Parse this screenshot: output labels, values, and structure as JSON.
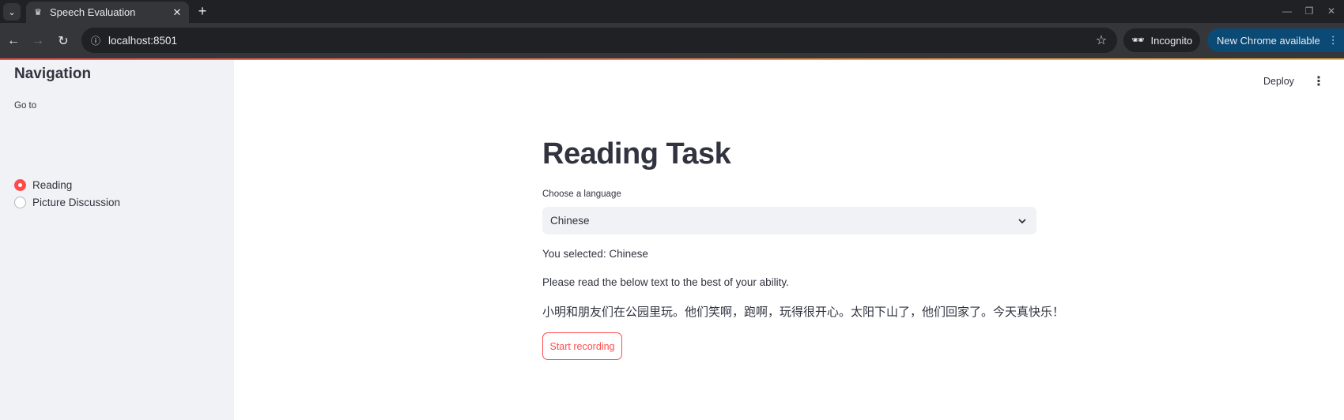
{
  "browser": {
    "tab_title": "Speech Evaluation",
    "url": "localhost:8501",
    "incognito_label": "Incognito",
    "update_label": "New Chrome available"
  },
  "sidebar": {
    "title": "Navigation",
    "radio_label": "Go to",
    "options": [
      {
        "label": "Reading",
        "selected": true
      },
      {
        "label": "Picture Discussion",
        "selected": false
      }
    ]
  },
  "header": {
    "deploy_label": "Deploy"
  },
  "main": {
    "title": "Reading Task",
    "language_select": {
      "label": "Choose a language",
      "value": "Chinese"
    },
    "selected_text": "You selected: Chinese",
    "instruction": "Please read the below text to the best of your ability.",
    "reading_text": "小明和朋友们在公园里玩。他们笑啊，跑啊，玩得很开心。太阳下山了，他们回家了。今天真快乐！",
    "record_button": "Start recording"
  },
  "colors": {
    "accent": "#ff4b4b",
    "sidebar_bg": "#f0f2f6",
    "text": "#31333f",
    "update_pill": "#0b4a75"
  }
}
